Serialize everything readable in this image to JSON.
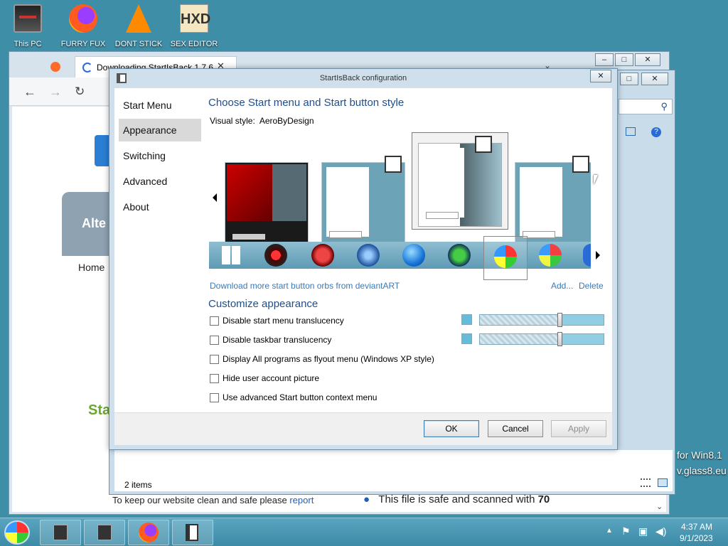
{
  "desktop": {
    "icons": [
      {
        "label": "This PC"
      },
      {
        "label": "FURRY FUX"
      },
      {
        "label": "DONT STICK"
      },
      {
        "label": "SEX EDITOR"
      }
    ],
    "right_text1": "for Win8.1",
    "right_text2": "v.glass8.eu"
  },
  "browser": {
    "tab_title": "Downloading StartIsBack 1.7.6",
    "site_text_alt": "Alte",
    "site_text_home": "Home",
    "site_text_sta": "Sta",
    "footer_left": "To keep our website clean and safe please",
    "footer_left_link": "report",
    "footer_right": "This file is safe and scanned with",
    "footer_right_bold": "70"
  },
  "explorer": {
    "status": "2 items"
  },
  "dialog": {
    "title": "StartIsBack configuration",
    "nav": [
      "Start Menu",
      "Appearance",
      "Switching",
      "Advanced",
      "About"
    ],
    "selected_nav": "Appearance",
    "heading": "Choose Start menu and Start button style",
    "visual_style_label": "Visual style:",
    "visual_style_value": "AeroByDesign",
    "download_link": "Download more start button orbs from deviantART",
    "add_link": "Add...",
    "delete_link": "Delete",
    "customize_heading": "Customize appearance",
    "options": [
      {
        "label": "Disable start menu translucency",
        "checked": false
      },
      {
        "label": "Disable taskbar translucency",
        "checked": false
      },
      {
        "label": "Display All programs as flyout menu (Windows XP style)",
        "checked": false
      },
      {
        "label": "Hide user account picture",
        "checked": false
      },
      {
        "label": "Use advanced Start button context menu",
        "checked": false
      }
    ],
    "sliders": [
      {
        "level": 0.65
      },
      {
        "level": 0.65
      }
    ],
    "buttons": {
      "ok": "OK",
      "cancel": "Cancel",
      "apply": "Apply"
    }
  },
  "taskbar": {
    "time": "4:37 AM",
    "date": "9/1/2023"
  },
  "colors": {
    "desktop": "#3e8ea8",
    "heading": "#1f4e8a",
    "link": "#3a79b8",
    "taskbar": "#4a98b4"
  }
}
